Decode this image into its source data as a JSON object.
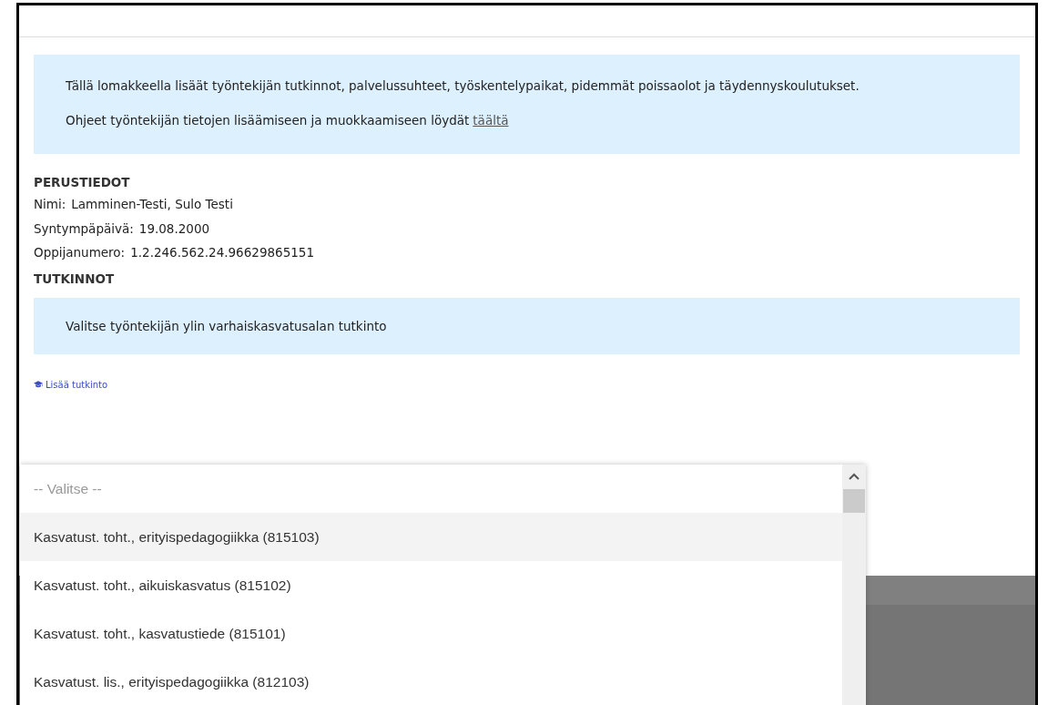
{
  "info": {
    "paragraphs": [
      "Tällä lomakkeella lisäät työntekijän tutkinnot, palvelussuhteet, työskentelypaikat, pidemmät poissaolot ja täydennyskoulutukset."
    ],
    "help_text": "Ohjeet työntekijän tietojen lisäämiseen ja muokkaamiseen löydät",
    "help_link": "täältä"
  },
  "basic": {
    "heading": "PERUSTIEDOT",
    "fields": [
      {
        "label": "Nimi:",
        "value": "Lamminen-Testi, Sulo Testi"
      },
      {
        "label": "Syntympäpäivä:",
        "value": "19.08.2000"
      },
      {
        "label": "Oppijanumero:",
        "value": "1.2.246.562.24.96629865151"
      }
    ]
  },
  "degrees": {
    "heading": "TUTKINNOT",
    "note": "Valitse työntekijän ylin varhaiskasvatusalan tutkinto",
    "add_link": "Lisää tutkinto"
  },
  "dropdown": {
    "options": [
      {
        "label": "-- Valitse --",
        "kind": "placeholder",
        "selected": false
      },
      {
        "label": "Kasvatust. toht., erityispedagogiikka (815103)",
        "kind": "option",
        "selected": true
      },
      {
        "label": "Kasvatust. toht., aikuiskasvatus (815102)",
        "kind": "option",
        "selected": false
      },
      {
        "label": "Kasvatust. toht., kasvatustiede (815101)",
        "kind": "option",
        "selected": false
      },
      {
        "label": "Kasvatust. lis., erityispedagogiikka (812103)",
        "kind": "option",
        "selected": false
      }
    ]
  }
}
